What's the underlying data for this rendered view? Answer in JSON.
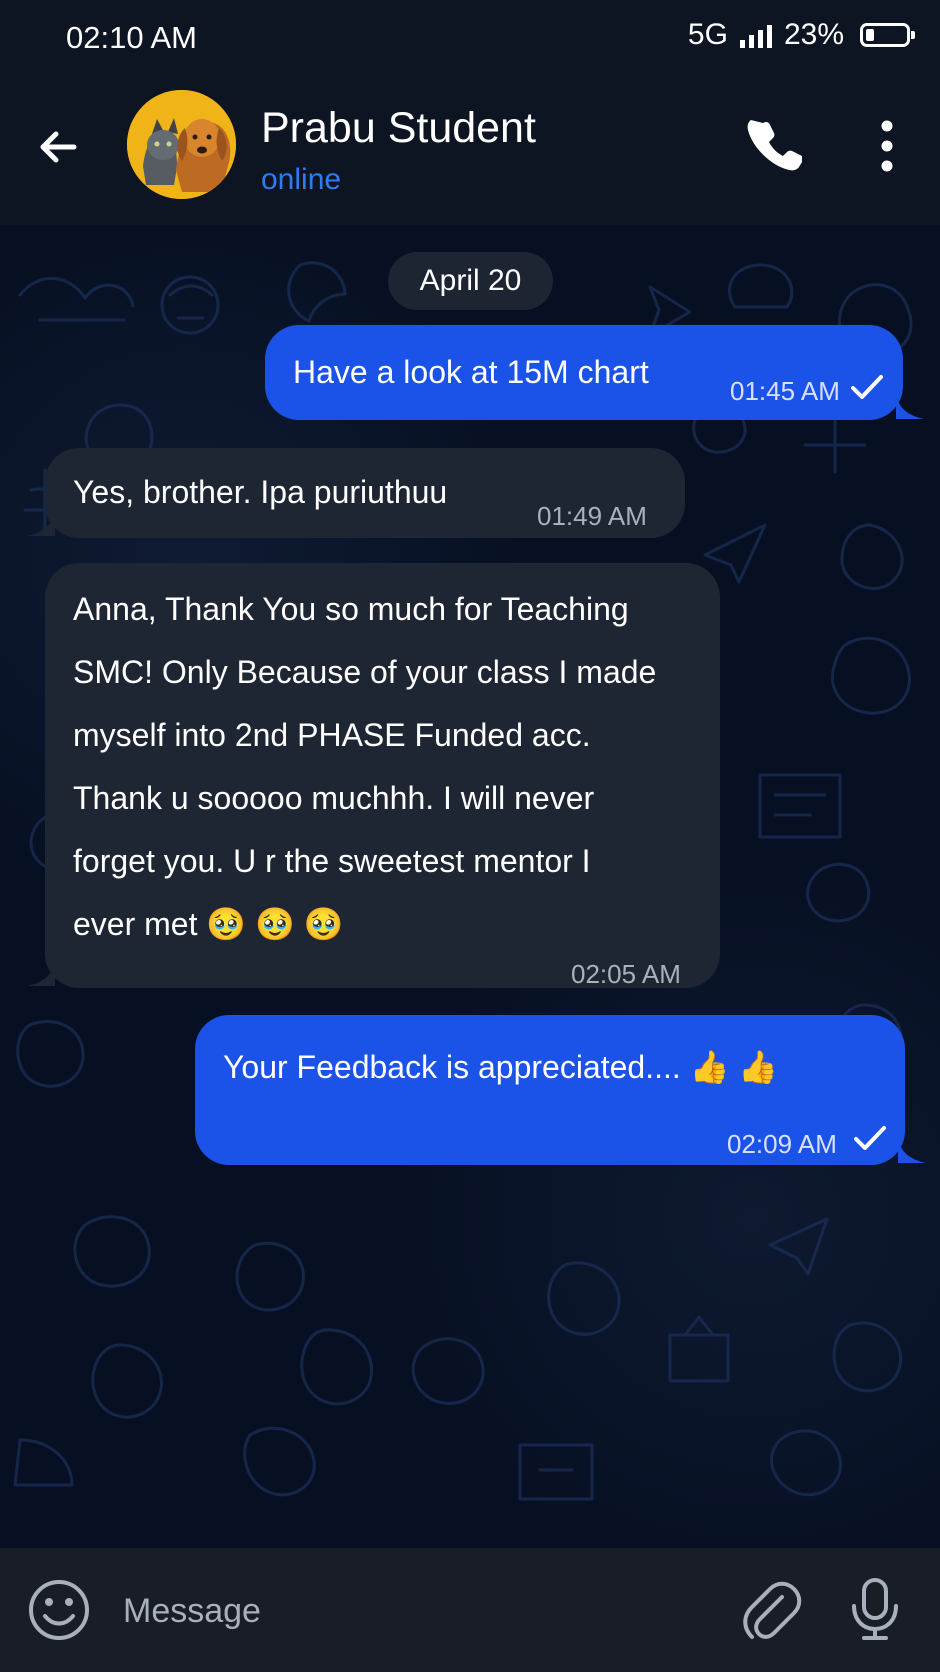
{
  "status_bar": {
    "time": "02:10 AM",
    "network": "5G",
    "battery": "23%",
    "signal_icon": "signal-bars-icon",
    "battery_icon": "battery-icon"
  },
  "header": {
    "title": "Prabu Student",
    "subtitle": "online",
    "back_icon": "arrow-left-icon",
    "call_icon": "phone-icon",
    "menu_icon": "three-dots-vertical-icon"
  },
  "chat": {
    "date_label": "April 20",
    "messages": [
      {
        "direction": "outgoing",
        "text": "Have a look at 15M chart",
        "time": "01:45 AM"
      },
      {
        "direction": "incoming",
        "text": "Yes, brother. Ipa puriuthuu",
        "time": "01:49 AM"
      },
      {
        "direction": "incoming",
        "lines": [
          "Anna, Thank You so much for Teaching",
          "SMC! Only Because of your class I made",
          "myself into 2nd PHASE Funded acc.",
          "Thank u sooooo muchhh. I will never",
          "forget you. U r the sweetest mentor I",
          "ever met 🥹 🥹 🥹"
        ],
        "time": "02:05 AM"
      },
      {
        "direction": "outgoing",
        "text": "Your Feedback is appreciated.... 👍 👍",
        "time": "02:09 AM"
      }
    ]
  },
  "composer": {
    "placeholder": "Message",
    "emoji_icon": "emoji-icon",
    "attach_icon": "paperclip-icon",
    "mic_icon": "microphone-icon"
  },
  "colors": {
    "outgoing_bubble": "#1b52e7",
    "incoming_bubble": "#1e2533",
    "accent": "#2d7cf4",
    "background": "#071022"
  }
}
